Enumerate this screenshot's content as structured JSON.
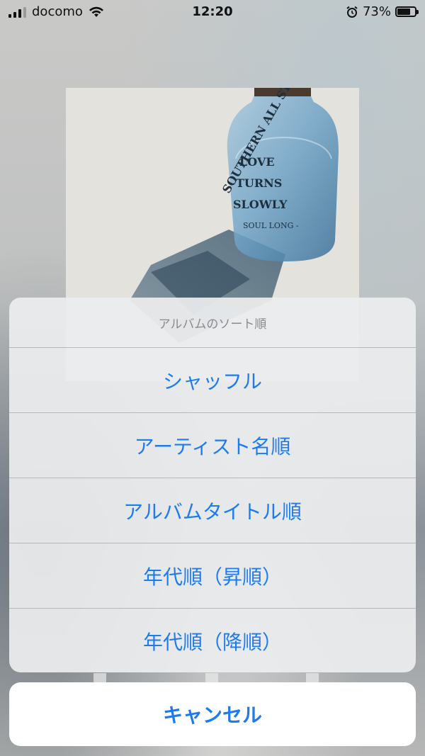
{
  "status_bar": {
    "carrier": "docomo",
    "time": "12:20",
    "battery_percent": "73%",
    "battery_level": 0.73
  },
  "album": {
    "bottle_text_arc": "SOUTHERN ALL STARS",
    "bottle_text_line1": "LOVE",
    "bottle_text_line2": "TURNS",
    "bottle_text_line3": "SLOWLY",
    "bottle_text_sub": "SOUL LONG -"
  },
  "action_sheet": {
    "title": "アルバムのソート順",
    "options": [
      {
        "label": "シャッフル"
      },
      {
        "label": "アーティスト名順"
      },
      {
        "label": "アルバムタイトル順"
      },
      {
        "label": "年代順（昇順）"
      },
      {
        "label": "年代順（降順）"
      }
    ],
    "cancel_label": "キャンセル"
  }
}
